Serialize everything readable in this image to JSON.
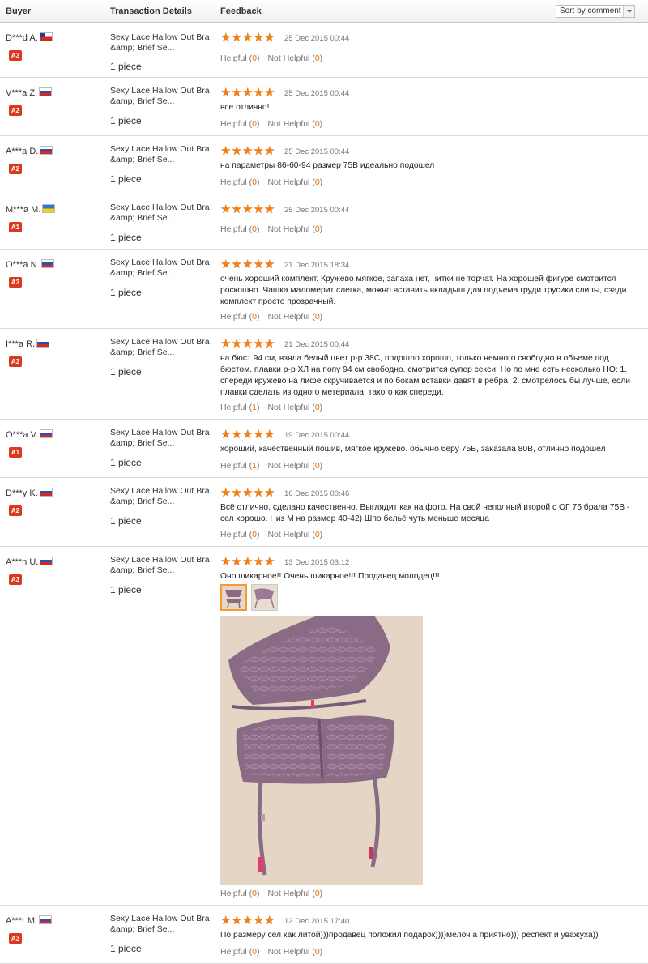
{
  "header": {
    "buyer": "Buyer",
    "transaction": "Transaction Details",
    "feedback": "Feedback",
    "sort": "Sort by comment"
  },
  "colors": {
    "star": "#f57f17",
    "badge": "#d9391c",
    "count": "#e46b00"
  },
  "reviews": [
    {
      "buyer": "D***d A.",
      "flag": "cl",
      "level": "A3",
      "product": "Sexy Lace Hallow Out Bra &amp; Brief Se...",
      "qty": "1 piece",
      "date": "25 Dec 2015 00:44",
      "comment": "",
      "helpful_label": "Helpful",
      "helpful": "0",
      "not_helpful_label": "Not Helpful",
      "not_helpful": "0"
    },
    {
      "buyer": "V***a Z.",
      "flag": "ru",
      "level": "A2",
      "product": "Sexy Lace Hallow Out Bra &amp; Brief Se...",
      "qty": "1 piece",
      "date": "25 Dec 2015 00:44",
      "comment": "все отлично!",
      "helpful_label": "Helpful",
      "helpful": "0",
      "not_helpful_label": "Not Helpful",
      "not_helpful": "0"
    },
    {
      "buyer": "A***a D.",
      "flag": "ru",
      "level": "A2",
      "product": "Sexy Lace Hallow Out Bra &amp; Brief Se...",
      "qty": "1 piece",
      "date": "25 Dec 2015 00:44",
      "comment": "на параметры 86-60-94 размер 75B идеально подошел",
      "helpful_label": "Helpful",
      "helpful": "0",
      "not_helpful_label": "Not Helpful",
      "not_helpful": "0"
    },
    {
      "buyer": "M***a M.",
      "flag": "ua",
      "level": "A1",
      "product": "Sexy Lace Hallow Out Bra &amp; Brief Se...",
      "qty": "1 piece",
      "date": "25 Dec 2015 00:44",
      "comment": "",
      "helpful_label": "Helpful",
      "helpful": "0",
      "not_helpful_label": "Not Helpful",
      "not_helpful": "0"
    },
    {
      "buyer": "O***a N.",
      "flag": "ru",
      "level": "A3",
      "product": "Sexy Lace Hallow Out Bra &amp; Brief Se...",
      "qty": "1 piece",
      "date": "21 Dec 2015 18:34",
      "comment": "очень хороший комплект. Кружево мягкое, запаха нет, нитки не торчат. На хорошей фигуре смотрится роскошно. Чашка маломерит слегка, можно вставить вкладыш для подъема груди трусики слипы, сзади комплект просто прозрачный.",
      "helpful_label": "Helpful",
      "helpful": "0",
      "not_helpful_label": "Not Helpful",
      "not_helpful": "0"
    },
    {
      "buyer": "I***a R.",
      "flag": "ru",
      "level": "A3",
      "product": "Sexy Lace Hallow Out Bra &amp; Brief Se...",
      "qty": "1 piece",
      "date": "21 Dec 2015 00:44",
      "comment": "на бюст 94 см, взяла белый цвет р-р 38C, подошло хорошо, только немного свободно в объеме под бюстом. плавки р-р ХЛ на попу 94 см свободно. смотрится супер секси. Но по мне есть несколько НО: 1. спереди кружево на лифе скручивается и по бокам вставки давят в ребра. 2. смотрелось бы лучше, если плавки сделать из одного метериала, такого как спереди.",
      "helpful_label": "Helpful",
      "helpful": "1",
      "not_helpful_label": "Not Helpful",
      "not_helpful": "0"
    },
    {
      "buyer": "O***a V.",
      "flag": "ru",
      "level": "A1",
      "product": "Sexy Lace Hallow Out Bra &amp; Brief Se...",
      "qty": "1 piece",
      "date": "19 Dec 2015 00:44",
      "comment": "хороший, качественный пошив, мягкое кружево. обычно беру 75B, заказала 80B, отлично подошел",
      "helpful_label": "Helpful",
      "helpful": "1",
      "not_helpful_label": "Not Helpful",
      "not_helpful": "0"
    },
    {
      "buyer": "D***y K.",
      "flag": "ru",
      "level": "A2",
      "product": "Sexy Lace Hallow Out Bra &amp; Brief Se...",
      "qty": "1 piece",
      "date": "16 Dec 2015 00:46",
      "comment": "Всё отлично, сделано качественно. Выглядит как на фото. На свой неполный второй с ОГ 75 брала 75В - сел хорошо. Низ М на размер 40-42) Шпо бельё чуть меньше месяца",
      "helpful_label": "Helpful",
      "helpful": "0",
      "not_helpful_label": "Not Helpful",
      "not_helpful": "0"
    },
    {
      "buyer": "A***n U.",
      "flag": "ru",
      "level": "A3",
      "product": "Sexy Lace Hallow Out Bra &amp; Brief Se...",
      "qty": "1 piece",
      "date": "13 Dec 2015 03:12",
      "comment": "Оно шикарное!! Очень шикарное!!! Продавец молодец!!!",
      "helpful_label": "Helpful",
      "helpful": "0",
      "not_helpful_label": "Not Helpful",
      "not_helpful": "0"
    },
    {
      "buyer": "A***r M.",
      "flag": "ru",
      "level": "A3",
      "product": "Sexy Lace Hallow Out Bra &amp; Brief Se...",
      "qty": "1 piece",
      "date": "12 Dec 2015 17:40",
      "comment": "По размеру сел как литой)))продавец положил подарок))))мелоч а приятно))) респект и уважуха))",
      "helpful_label": "Helpful",
      "helpful": "0",
      "not_helpful_label": "Not Helpful",
      "not_helpful": "0"
    }
  ]
}
